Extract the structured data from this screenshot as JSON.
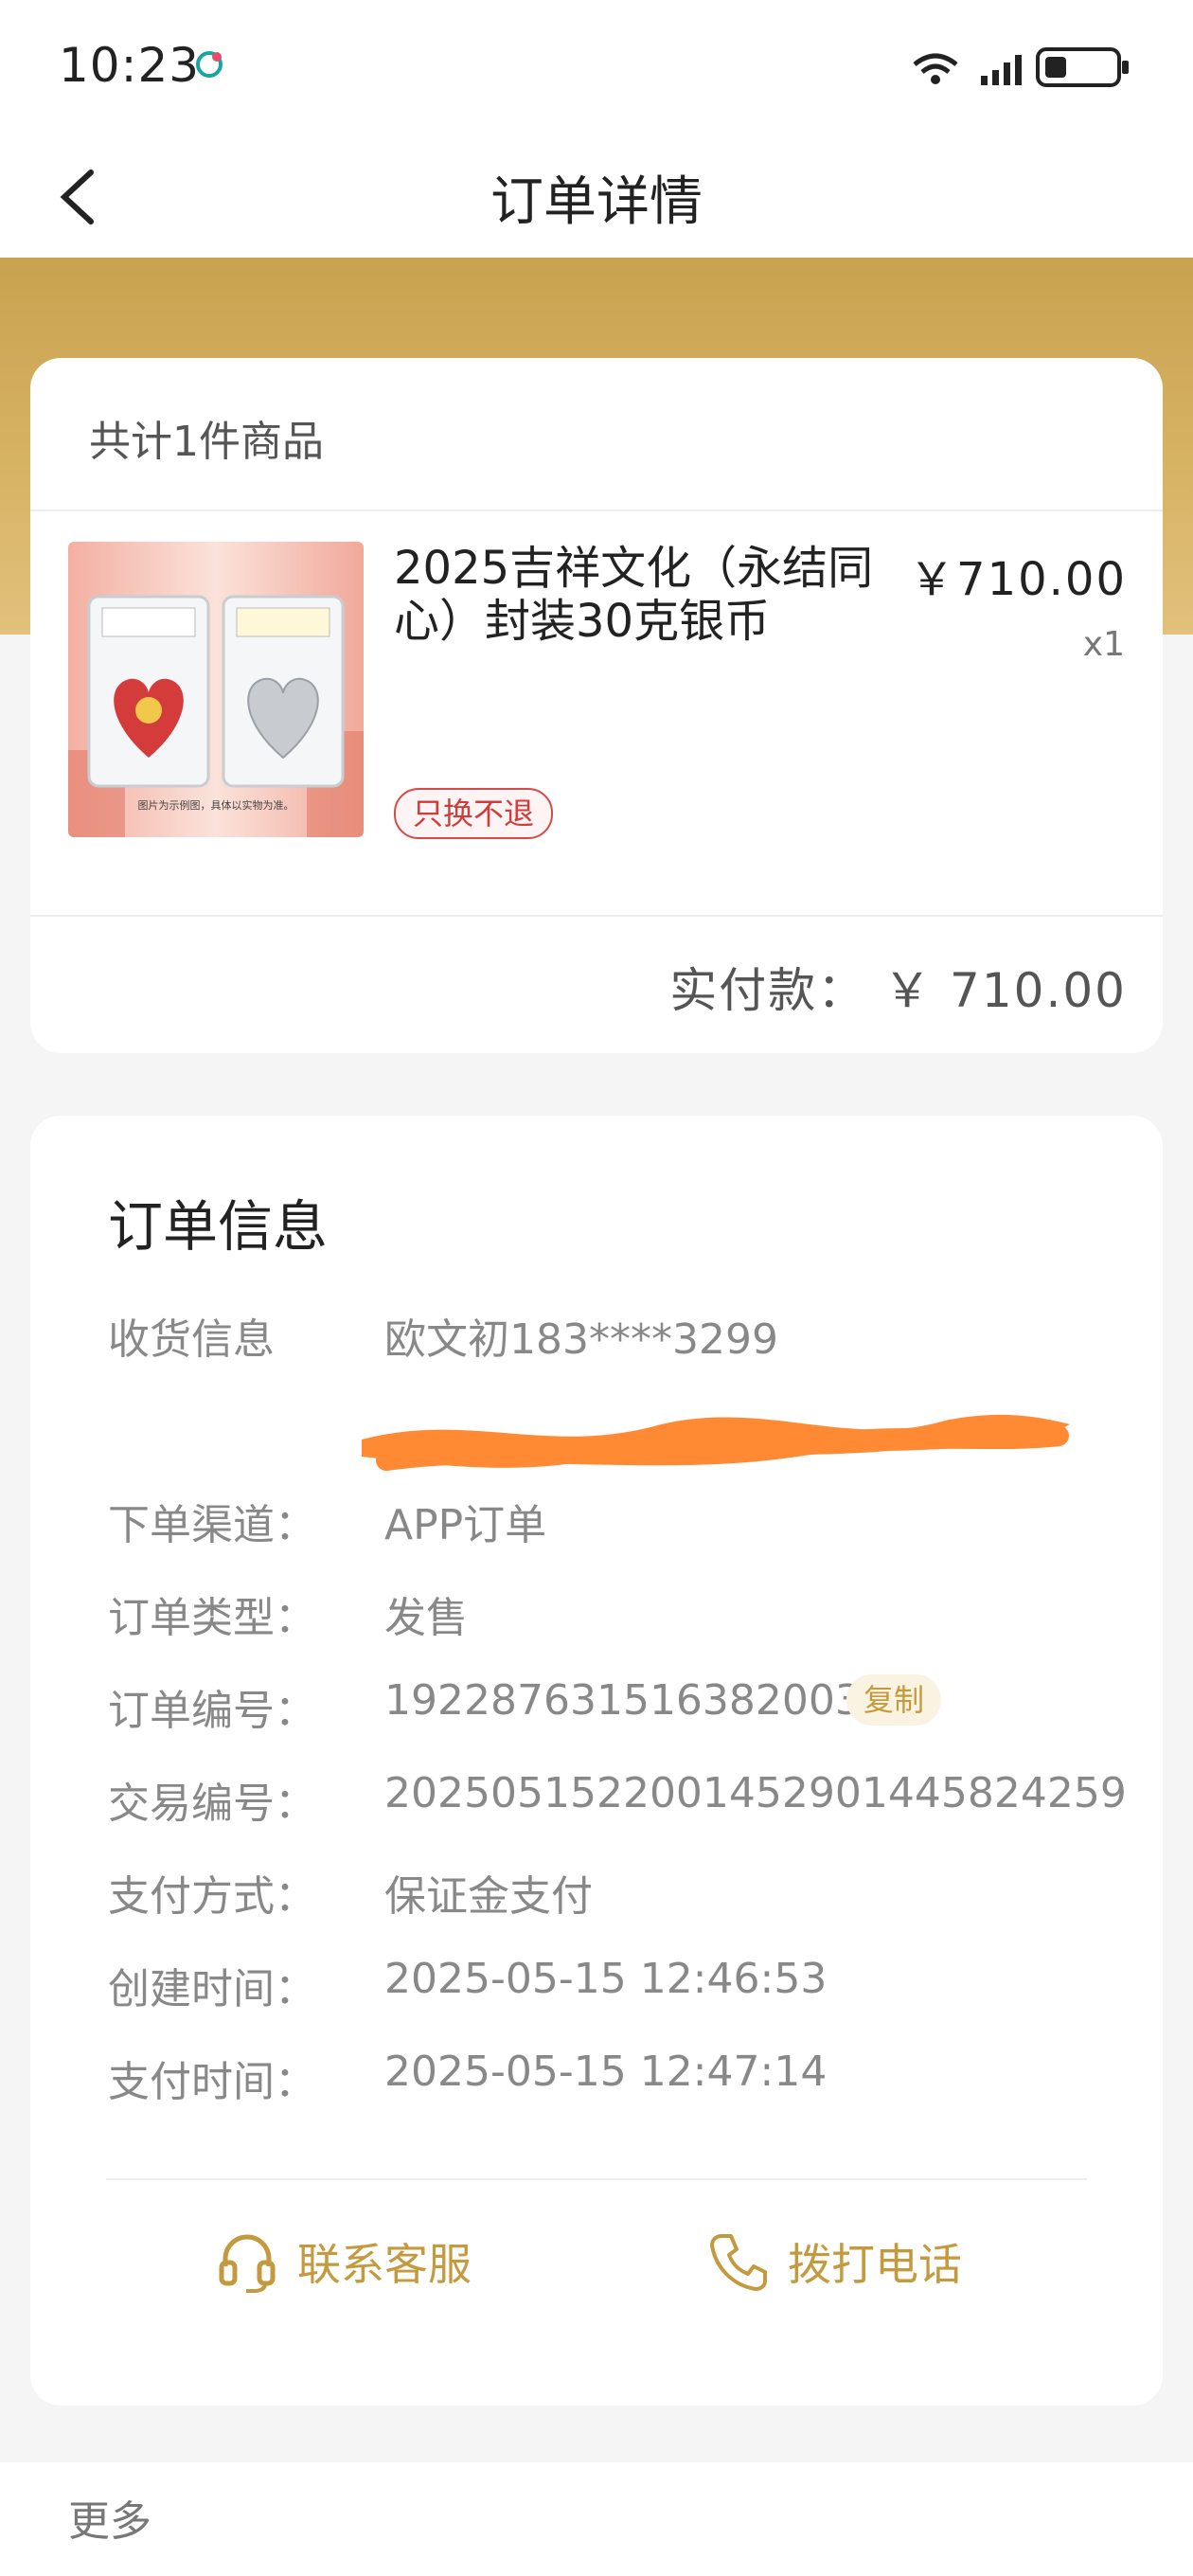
{
  "status_bar": {
    "time": "10:23"
  },
  "nav": {
    "title": "订单详情"
  },
  "goods": {
    "count_text": "共计1件商品",
    "name": "2025吉祥文化（永结同心）封装30克银币",
    "price": "￥710.00",
    "qty": "x1",
    "tag": "只换不退",
    "paid_label": "实付款：",
    "paid_value": "￥ 710.00",
    "thumb_caption": "图片为示例图，具体以实物为准。"
  },
  "order_info": {
    "title": "订单信息",
    "rows": [
      {
        "label": "收货信息",
        "value": "欧文初183****3299"
      },
      {
        "label": "下单渠道：",
        "value": "APP订单"
      },
      {
        "label": "订单类型：",
        "value": "发售"
      },
      {
        "label": "订单编号：",
        "value": "1922876315163820033"
      },
      {
        "label": "交易编号：",
        "value": "2025051522001452901445824259"
      },
      {
        "label": "支付方式：",
        "value": "保证金支付"
      },
      {
        "label": "创建时间：",
        "value": "2025-05-15 12:46:53"
      },
      {
        "label": "支付时间：",
        "value": "2025-05-15 12:47:14"
      }
    ],
    "copy_label": "复制",
    "contact_service": "联系客服",
    "call_phone": "拨打电话"
  },
  "footer": {
    "more": "更多"
  },
  "colors": {
    "gold": "#c9a24f",
    "accent": "#c49a3f",
    "tag_red": "#d33a3a",
    "redaction": "#ff8a33"
  }
}
